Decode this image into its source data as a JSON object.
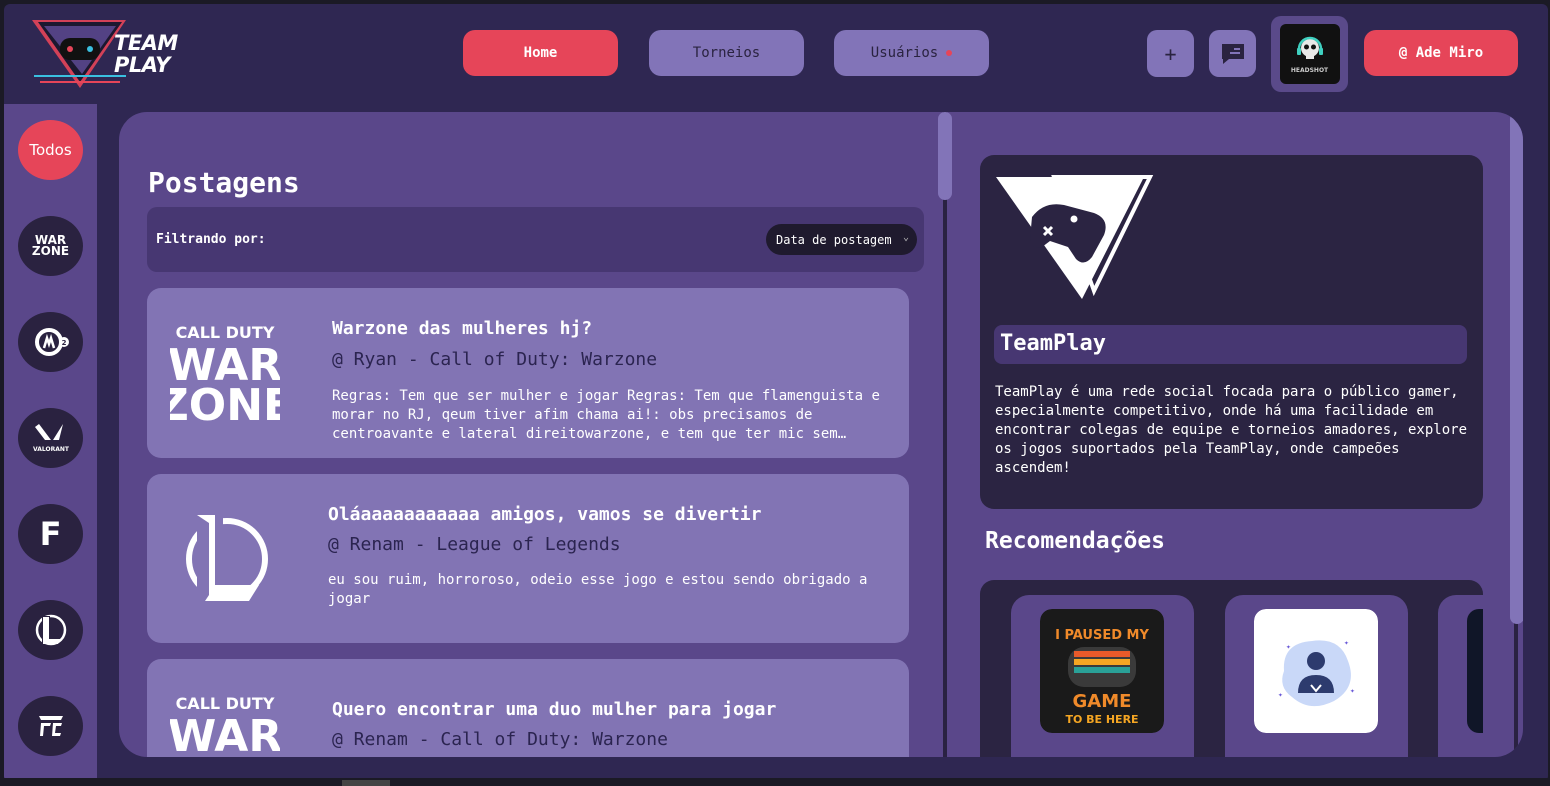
{
  "header": {
    "logo_line1": "TEAM",
    "logo_line2": "PLAY",
    "nav": [
      {
        "label": "Home"
      },
      {
        "label": "Torneios"
      },
      {
        "label": "Usuários"
      }
    ],
    "plus_label": "+",
    "avatar_caption": "HEADSHOT",
    "user_label": "@ Ade Miro"
  },
  "sidebar": {
    "all_label": "Todos",
    "games": [
      {
        "label": "WAR ZONE",
        "icon": "warzone-icon"
      },
      {
        "label": "2",
        "icon": "overwatch-icon"
      },
      {
        "label": "VALORANT",
        "icon": "valorant-icon"
      },
      {
        "label": "F",
        "icon": "fortnite-icon"
      },
      {
        "label": "L",
        "icon": "league-icon"
      },
      {
        "label": "FC",
        "icon": "fc-icon"
      }
    ]
  },
  "posts": {
    "title": "Postagens",
    "filter_label": "Filtrando por:",
    "filter_value": "Data de postagem",
    "items": [
      {
        "title": "Warzone das mulheres hj?",
        "author": "@ Ryan - Call of Duty: Warzone",
        "body": "Regras: Tem que ser mulher e jogar Regras: Tem que flamenguista e morar no RJ, qeum tiver afim chama ai!: obs precisamos de centroavante e lateral direitowarzone, e tem que ter mic sem…",
        "game": "warzone"
      },
      {
        "title": "Oláaaaaaaaaaaa amigos, vamos se divertir",
        "author": "@ Renam - League of Legends",
        "body": "eu sou ruim, horroroso, odeio esse jogo e estou sendo obrigado a jogar",
        "game": "league"
      },
      {
        "title": "Quero encontrar uma duo mulher para jogar",
        "author": "@ Renam - Call of Duty: Warzone",
        "body": "",
        "game": "warzone"
      }
    ],
    "warzone_logo": {
      "line1": "CALL DUTY",
      "line2": "WAR",
      "line3": "ZONE"
    }
  },
  "info": {
    "title": "TeamPlay",
    "text": "TeamPlay é uma rede social focada para o público gamer, especialmente competitivo, onde há uma facilidade em encontrar colegas de equipe e torneios amadores, explore os jogos suportados pela TeamPlay, onde campeões ascendem!"
  },
  "recommendations": {
    "title": "Recomendações",
    "cards": [
      {
        "image_text_1": "I PAUSED MY",
        "image_text_2": "GAME",
        "image_text_3": "TO BE HERE"
      },
      {
        "icon": "default-user-icon"
      },
      {
        "icon": "partial-avatar"
      }
    ]
  },
  "colors": {
    "accent": "#e64559",
    "panel": "#5a478a",
    "card": "#8274b4",
    "dark": "#2b2442"
  }
}
